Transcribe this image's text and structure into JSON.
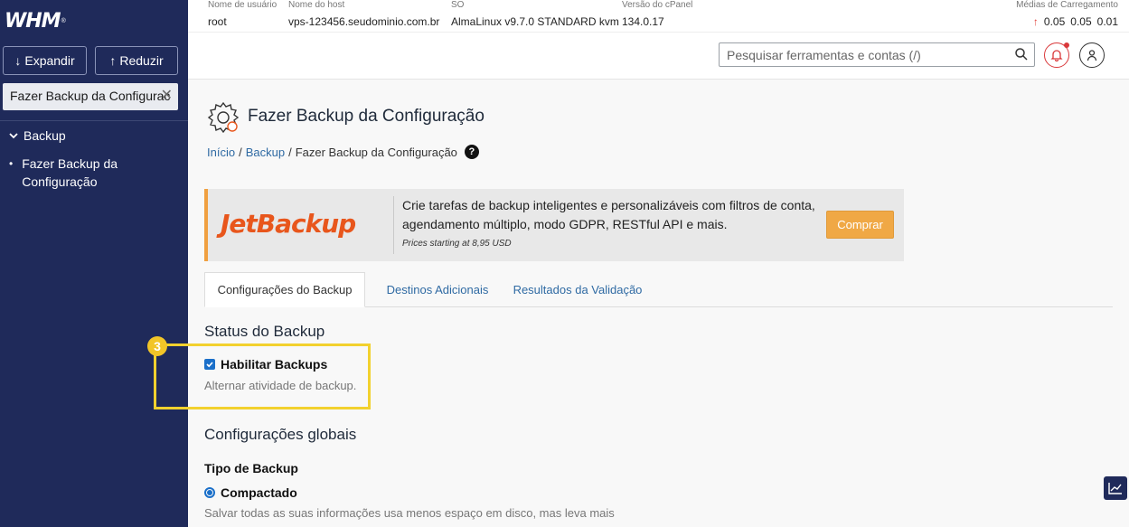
{
  "sidebar": {
    "logo": "WHM",
    "logo_mark": "®",
    "expand_label": "Expandir",
    "collapse_label": "Reduzir",
    "search_value": "Fazer Backup da Configurac",
    "group_label": "Backup",
    "items": [
      {
        "label": "Fazer Backup da Configuração"
      }
    ]
  },
  "topbar": {
    "user": {
      "label": "Nome de usuário",
      "value": "root"
    },
    "host": {
      "label": "Nome do host",
      "value": "vps-123456.seudominio.com.br"
    },
    "os": {
      "label": "SO",
      "value": "AlmaLinux v9.7.0 STANDARD kvm"
    },
    "cpanel": {
      "label": "Versão do cPanel",
      "value": "134.0.17"
    },
    "load": {
      "label": "Médias de Carregamento",
      "values": [
        "0.05",
        "0.05",
        "0.01"
      ]
    }
  },
  "search": {
    "placeholder": "Pesquisar ferramentas e contas (/)"
  },
  "page": {
    "title": "Fazer Backup da Configuração",
    "breadcrumb": {
      "home": "Início",
      "sep": "/",
      "parent": "Backup",
      "current": "Fazer Backup da Configuração"
    }
  },
  "promo": {
    "logo": "JetBackup",
    "text": "Crie tarefas de backup inteligentes e personalizáveis com filtros de conta, agendamento múltiplo, modo GDPR, RESTful API e mais.",
    "price": "Prices starting at 8,95 USD",
    "button": "Comprar"
  },
  "tabs": [
    {
      "label": "Configurações do Backup",
      "active": true
    },
    {
      "label": "Destinos Adicionais",
      "active": false
    },
    {
      "label": "Resultados da Validação",
      "active": false
    }
  ],
  "backup_status": {
    "title": "Status do Backup",
    "checkbox_label": "Habilitar Backups",
    "checked": true,
    "help": "Alternar atividade de backup.",
    "step": "3"
  },
  "global": {
    "title": "Configurações globais",
    "type_label": "Tipo de Backup",
    "option_label": "Compactado",
    "option_help": "Salvar todas as suas informações usa menos espaço em disco, mas leva mais"
  },
  "colors": {
    "sidebar": "#1f2a5a",
    "accent": "#1a6fc9",
    "highlight": "#f2d12e",
    "promo_button": "#f0a845"
  }
}
